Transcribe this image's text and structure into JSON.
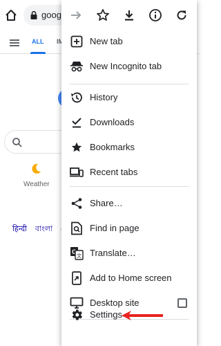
{
  "toolbar": {
    "url": "goog"
  },
  "page": {
    "tab_all": "ALL",
    "tab_images": "IM",
    "weather_label": "Weather",
    "languages": [
      "हिन्दी",
      "বাংলা",
      "త"
    ]
  },
  "menu": {
    "top_icons": [
      "forward-arrow-icon",
      "bookmark-star-icon",
      "download-icon",
      "info-icon",
      "refresh-icon"
    ],
    "items": [
      {
        "label": "New tab",
        "icon": "plus-box-icon"
      },
      {
        "label": "New Incognito tab",
        "icon": "incognito-icon"
      },
      {
        "label": "History",
        "icon": "history-icon"
      },
      {
        "label": "Downloads",
        "icon": "downloads-check-icon"
      },
      {
        "label": "Bookmarks",
        "icon": "star-icon"
      },
      {
        "label": "Recent tabs",
        "icon": "recent-tabs-icon"
      },
      {
        "label": "Share…",
        "icon": "share-icon"
      },
      {
        "label": "Find in page",
        "icon": "find-in-page-icon"
      },
      {
        "label": "Translate…",
        "icon": "translate-icon"
      },
      {
        "label": "Add to Home screen",
        "icon": "add-to-home-icon"
      },
      {
        "label": "Desktop site",
        "icon": "desktop-icon",
        "checked": false
      },
      {
        "label": "Settings",
        "icon": "gear-icon"
      }
    ]
  },
  "colors": {
    "accent": "#1a73e8",
    "arrow": "#e8231f"
  }
}
